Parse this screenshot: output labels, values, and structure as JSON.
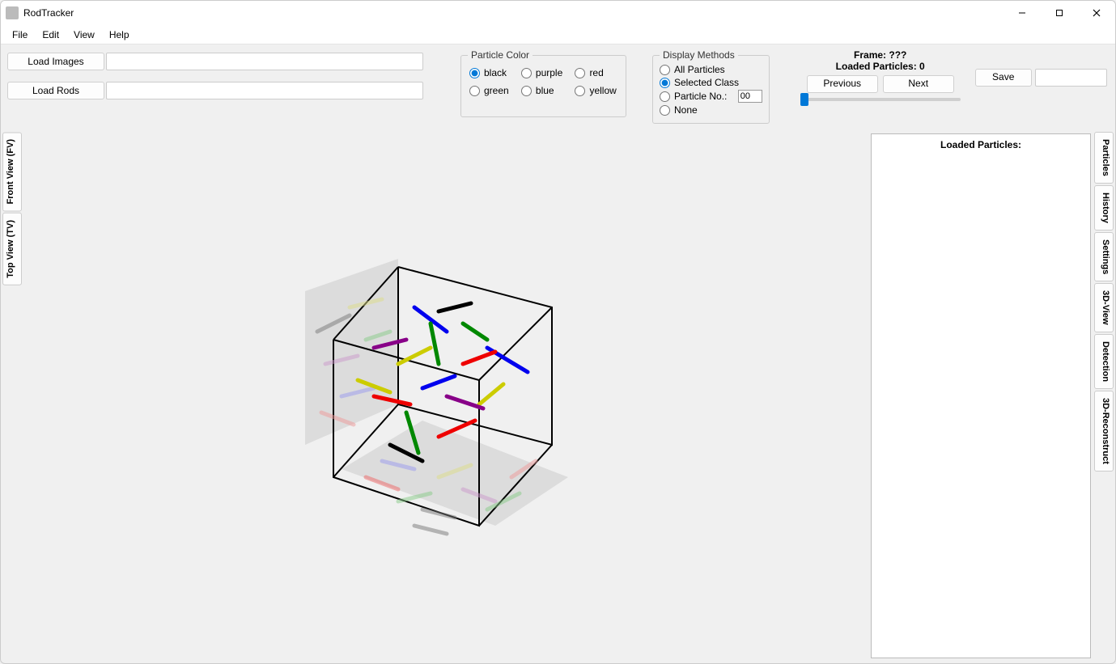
{
  "app": {
    "title": "RodTracker"
  },
  "menu": {
    "file": "File",
    "edit": "Edit",
    "view": "View",
    "help": "Help"
  },
  "buttons": {
    "load_images": "Load Images",
    "load_rods": "Load Rods",
    "previous": "Previous",
    "next": "Next",
    "save": "Save"
  },
  "groups": {
    "particle_color": "Particle Color",
    "display_methods": "Display Methods"
  },
  "colors": {
    "black": "black",
    "purple": "purple",
    "red": "red",
    "green": "green",
    "blue": "blue",
    "yellow": "yellow"
  },
  "display": {
    "all": "All Particles",
    "selected": "Selected Class",
    "number_label": "Particle No.:",
    "number_value": "00",
    "none": "None"
  },
  "frame": {
    "label": "Frame: ???",
    "loaded": "Loaded Particles: 0"
  },
  "left_tabs": {
    "front": "Front View (FV)",
    "top": "Top View (TV)"
  },
  "right_tabs": {
    "particles": "Particles",
    "history": "History",
    "settings": "Settings",
    "view3d": "3D-View",
    "detection": "Detection",
    "reconstruct": "3D-Reconstruct"
  },
  "side_panel": {
    "header": "Loaded Particles:"
  }
}
